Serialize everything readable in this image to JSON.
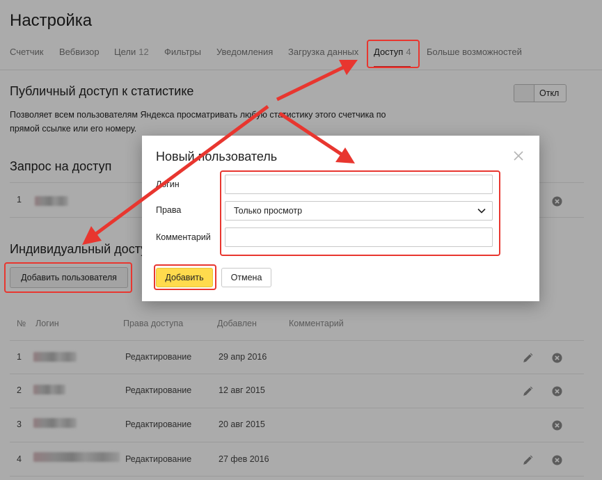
{
  "page": {
    "title": "Настройка"
  },
  "tabs": [
    {
      "label": "Счетчик",
      "count": ""
    },
    {
      "label": "Вебвизор",
      "count": ""
    },
    {
      "label": "Цели",
      "count": "12"
    },
    {
      "label": "Фильтры",
      "count": ""
    },
    {
      "label": "Уведомления",
      "count": ""
    },
    {
      "label": "Загрузка данных",
      "count": ""
    },
    {
      "label": "Доступ",
      "count": "4",
      "active": true
    },
    {
      "label": "Больше возможностей",
      "count": ""
    }
  ],
  "public_access": {
    "title": "Публичный доступ к статистике",
    "description": "Позволяет всем пользователям Яндекса просматривать любую статистику этого счетчика по прямой ссылке или его номеру.",
    "toggle_label": "Откл"
  },
  "access_request": {
    "title": "Запрос на доступ",
    "rows": [
      {
        "num": "1"
      }
    ]
  },
  "individual": {
    "title": "Индивидуальный доступ",
    "add_button": "Добавить пользователя",
    "columns": {
      "num": "№",
      "login": "Логин",
      "rights": "Права доступа",
      "added": "Добавлен",
      "comment": "Комментарий"
    },
    "rows": [
      {
        "num": "1",
        "rights": "Редактирование",
        "added": "29 апр 2016",
        "editable": true
      },
      {
        "num": "2",
        "rights": "Редактирование",
        "added": "12 авг 2015",
        "editable": true
      },
      {
        "num": "3",
        "rights": "Редактирование",
        "added": "20 авг 2015",
        "editable": false
      },
      {
        "num": "4",
        "rights": "Редактирование",
        "added": "27 фев 2016",
        "editable": true
      }
    ]
  },
  "modal": {
    "title": "Новый пользователь",
    "login_label": "Логин",
    "login_value": "",
    "rights_label": "Права",
    "rights_value": "Только просмотр",
    "comment_label": "Комментарий",
    "comment_value": "",
    "add_button": "Добавить",
    "cancel_button": "Отмена"
  },
  "colors": {
    "highlight": "#e8362f",
    "primary_button": "#ffdb4d",
    "active_tab_underline": "#ff2f2f",
    "overlay": "rgba(0,0,0,0.33)"
  },
  "icons": {
    "edit": "pencil-icon",
    "delete": "close-circle-icon",
    "select": "chevron-down-icon",
    "modal_close": "close-icon"
  }
}
